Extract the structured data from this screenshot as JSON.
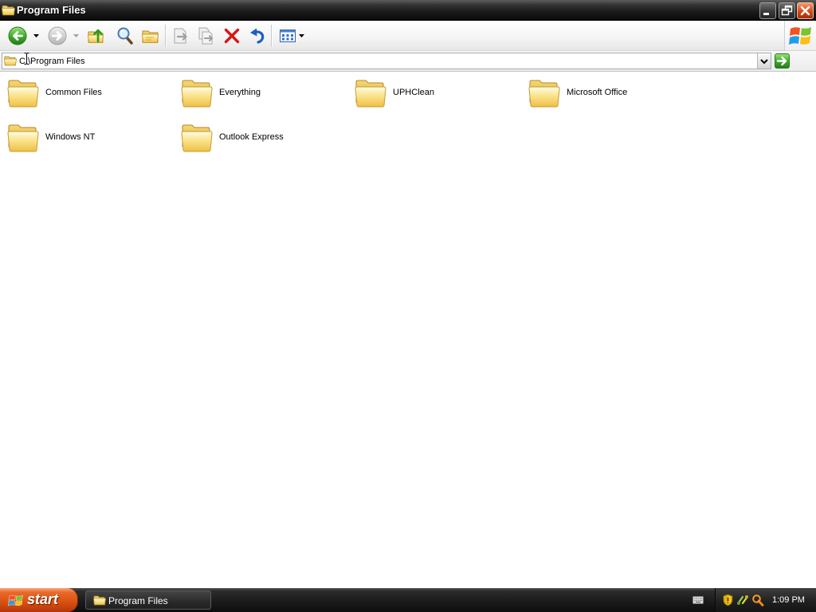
{
  "window": {
    "title": "Program Files",
    "title_icon": "folder-icon",
    "controls": {
      "minimize": "minimize-icon",
      "restore": "restore-icon",
      "close": "close-icon"
    }
  },
  "toolbar": {
    "back": {
      "icon": "back-arrow-icon",
      "enabled": true
    },
    "forward": {
      "icon": "forward-arrow-icon",
      "enabled": false
    },
    "up": {
      "icon": "up-folder-icon",
      "enabled": true
    },
    "search": {
      "icon": "search-icon",
      "enabled": true
    },
    "folders": {
      "icon": "folders-icon",
      "enabled": true
    },
    "move_to": {
      "icon": "move-to-icon",
      "enabled": false
    },
    "copy_to": {
      "icon": "copy-to-icon",
      "enabled": false
    },
    "delete": {
      "icon": "delete-icon",
      "enabled": true
    },
    "undo": {
      "icon": "undo-icon",
      "enabled": true
    },
    "views": {
      "icon": "views-icon",
      "enabled": true
    },
    "brand": {
      "icon": "windows-logo-icon"
    }
  },
  "address_bar": {
    "value": "C:\\Program Files",
    "icon": "folder-icon",
    "dropdown_icon": "chevron-down-icon",
    "go_icon": "go-arrow-icon"
  },
  "folders": [
    {
      "name": "Common Files",
      "icon": "folder-icon"
    },
    {
      "name": "Everything",
      "icon": "folder-icon"
    },
    {
      "name": "UPHClean",
      "icon": "folder-icon"
    },
    {
      "name": "Microsoft Office",
      "icon": "folder-icon"
    },
    {
      "name": "Windows NT",
      "icon": "folder-icon"
    },
    {
      "name": "Outlook Express",
      "icon": "folder-icon"
    }
  ],
  "taskbar": {
    "start_label": "start",
    "start_icon": "windows-flag-icon",
    "tasks": [
      {
        "label": "Program Files",
        "icon": "folder-icon",
        "active": true
      }
    ],
    "tray_icons": [
      "keyboard-icon",
      "security-shield-icon",
      "network-icon",
      "search-icon"
    ],
    "clock": "1:09 PM"
  },
  "colors": {
    "titlebar": "#1a1a1a",
    "taskbar": "#1b1b1b",
    "start_button": "#d9500f",
    "close_button": "#d24a1a",
    "content_background": "#ffffff"
  }
}
